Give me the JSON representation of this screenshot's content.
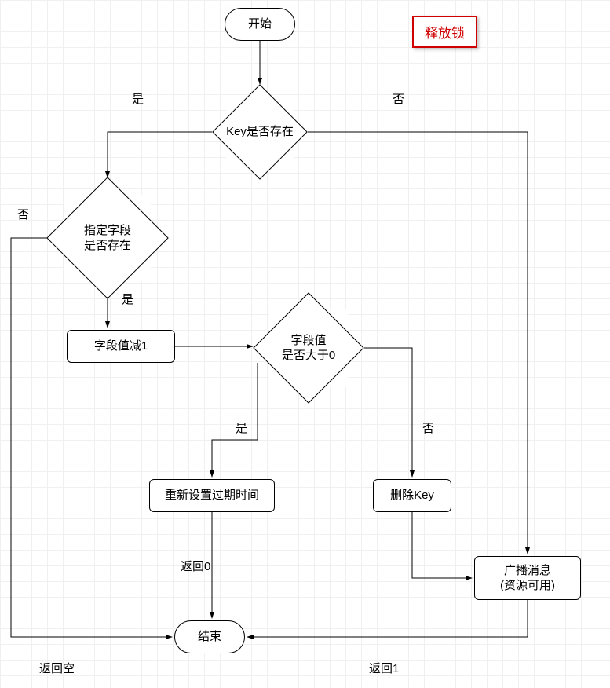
{
  "title": "释放锁",
  "nodes": {
    "start": "开始",
    "keyExists": "Key是否存在",
    "fieldExists": "指定字段\n是否存在",
    "decrement": "字段值减1",
    "valueGtZero": "字段值\n是否大于0",
    "resetExpire": "重新设置过期时间",
    "deleteKey": "删除Key",
    "broadcast": "广播消息\n(资源可用)",
    "end": "结束"
  },
  "edgeLabels": {
    "keyExists_yes": "是",
    "keyExists_no": "否",
    "fieldExists_yes": "是",
    "fieldExists_no": "否",
    "valueGtZero_yes": "是",
    "valueGtZero_no": "否",
    "return0": "返回0",
    "returnEmpty": "返回空",
    "return1": "返回1"
  },
  "chart_data": {
    "type": "flowchart",
    "title": "释放锁",
    "nodes": [
      {
        "id": "start",
        "type": "terminal",
        "label": "开始"
      },
      {
        "id": "keyExists",
        "type": "decision",
        "label": "Key是否存在"
      },
      {
        "id": "fieldExists",
        "type": "decision",
        "label": "指定字段是否存在"
      },
      {
        "id": "decrement",
        "type": "process",
        "label": "字段值减1"
      },
      {
        "id": "valueGtZero",
        "type": "decision",
        "label": "字段值是否大于0"
      },
      {
        "id": "resetExpire",
        "type": "process",
        "label": "重新设置过期时间"
      },
      {
        "id": "deleteKey",
        "type": "process",
        "label": "删除Key"
      },
      {
        "id": "broadcast",
        "type": "process",
        "label": "广播消息(资源可用)"
      },
      {
        "id": "end",
        "type": "terminal",
        "label": "结束"
      }
    ],
    "edges": [
      {
        "from": "start",
        "to": "keyExists"
      },
      {
        "from": "keyExists",
        "to": "fieldExists",
        "label": "是"
      },
      {
        "from": "keyExists",
        "to": "broadcast",
        "label": "否"
      },
      {
        "from": "fieldExists",
        "to": "decrement",
        "label": "是"
      },
      {
        "from": "fieldExists",
        "to": "end",
        "label": "否 / 返回空"
      },
      {
        "from": "decrement",
        "to": "valueGtZero"
      },
      {
        "from": "valueGtZero",
        "to": "resetExpire",
        "label": "是"
      },
      {
        "from": "valueGtZero",
        "to": "deleteKey",
        "label": "否"
      },
      {
        "from": "resetExpire",
        "to": "end",
        "label": "返回0"
      },
      {
        "from": "deleteKey",
        "to": "broadcast"
      },
      {
        "from": "broadcast",
        "to": "end",
        "label": "返回1"
      }
    ]
  }
}
